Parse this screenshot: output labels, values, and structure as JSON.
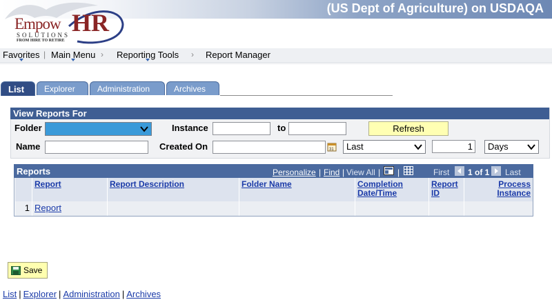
{
  "header": {
    "system_title": "(US Dept of Agriculture) on USDAQA",
    "logo": {
      "word1": "Empow",
      "word2": "HR",
      "sub": "SOLUTIONS",
      "tagline": "FROM HIRE TO RETIRE"
    }
  },
  "nav": {
    "items": [
      "Favorites",
      "Main Menu",
      "Reporting Tools",
      "Report Manager"
    ]
  },
  "tabs": [
    "List",
    "Explorer",
    "Administration",
    "Archives"
  ],
  "search": {
    "header": "View Reports For",
    "folder_label": "Folder",
    "instance_label": "Instance",
    "to_label": "to",
    "refresh_label": "Refresh",
    "name_label": "Name",
    "created_on_label": "Created On",
    "period_select": "Last",
    "period_value": "1",
    "unit_select": "Days"
  },
  "grid": {
    "title": "Reports",
    "personalize": "Personalize",
    "find": "Find",
    "view_all": "View All",
    "first": "First",
    "range": "1 of 1",
    "last": "Last",
    "columns": [
      "Report",
      "Report Description",
      "Folder Name",
      "Completion Date/Time",
      "Report ID",
      "Process Instance"
    ],
    "rows": [
      {
        "num": "1",
        "report": "Report",
        "description": "",
        "folder": "",
        "completion": "",
        "report_id": "",
        "instance": ""
      }
    ]
  },
  "save_label": "Save",
  "footer_links": [
    "List",
    "Explorer",
    "Administration",
    "Archives"
  ],
  "colors": {
    "header_blue": "#3f5e93",
    "tab_active": "#314d85",
    "tab_inactive": "#7a9ccb",
    "button_yellow": "#ffffb3",
    "link": "#1a3aa8"
  }
}
